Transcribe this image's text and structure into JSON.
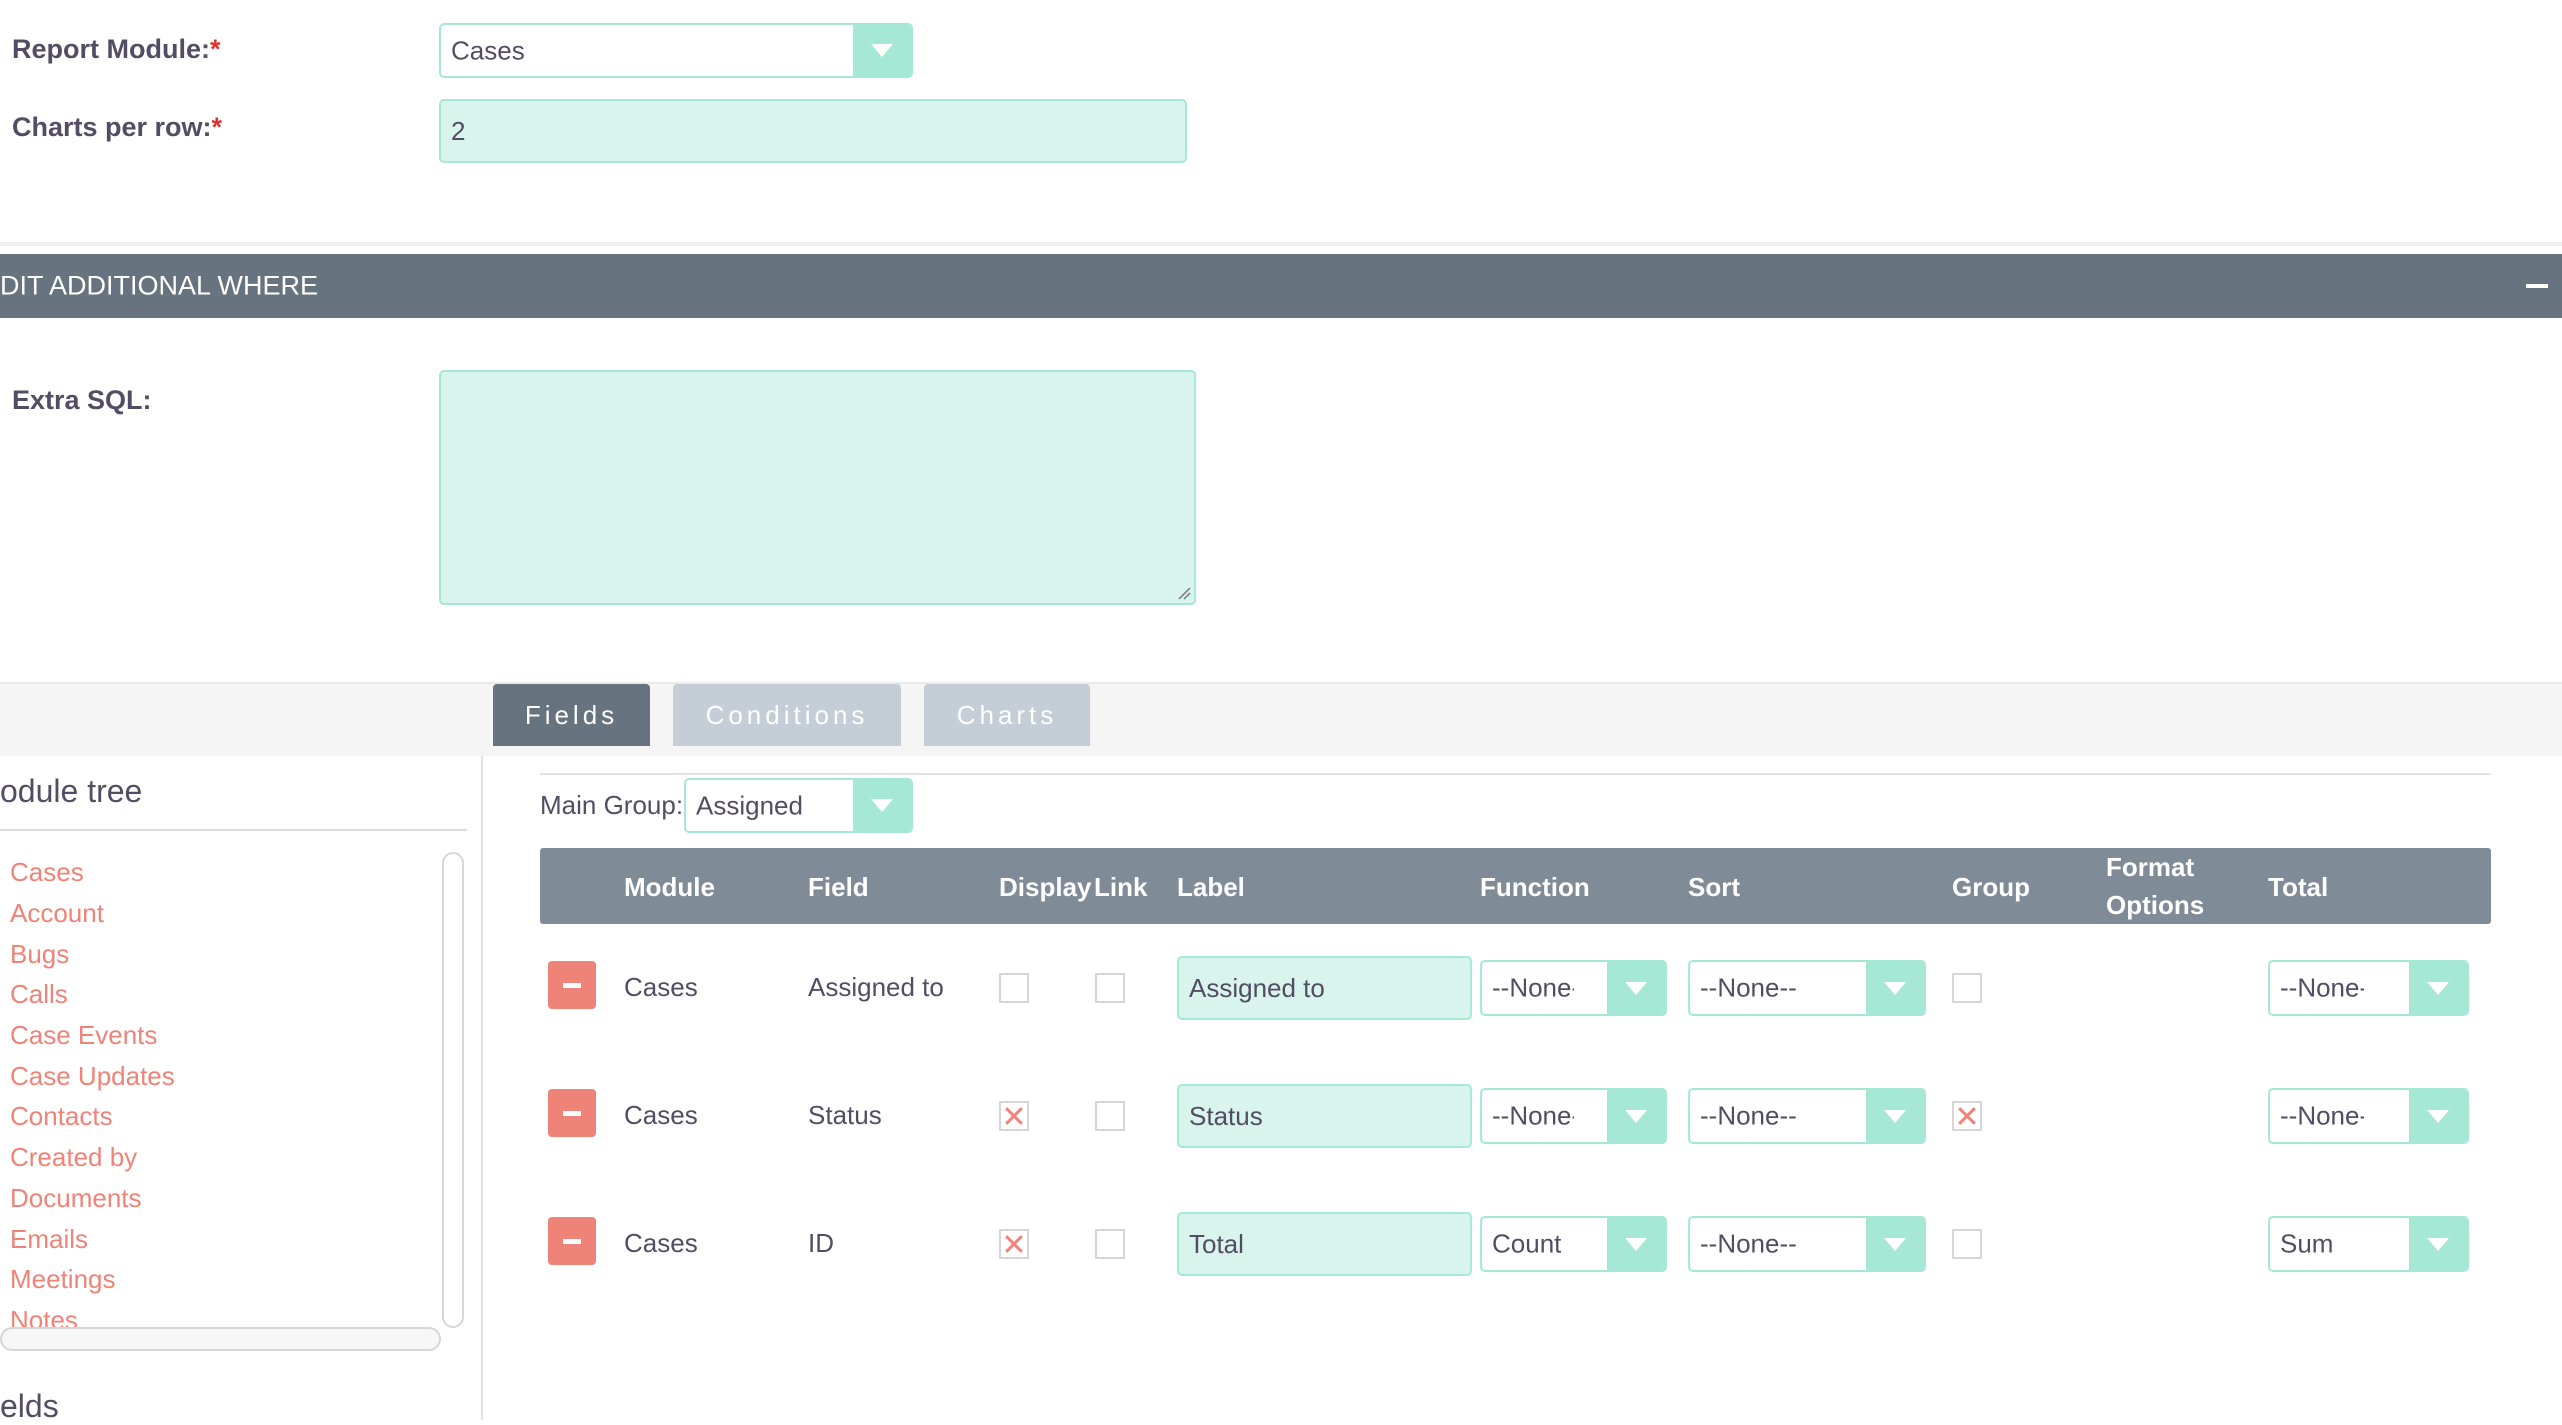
{
  "form": {
    "report_module_label": "Report Module:",
    "report_module_value": "Cases",
    "charts_per_row_label": "Charts per row:",
    "charts_per_row_value": "2",
    "required_mark": "*"
  },
  "section": {
    "title": "DIT ADDITIONAL WHERE",
    "extra_sql_label": "Extra SQL:",
    "extra_sql_value": ""
  },
  "tabs": {
    "fields": "Fields",
    "conditions": "Conditions",
    "charts": "Charts"
  },
  "tree": {
    "title": "odule tree",
    "items": [
      "Cases",
      "Account",
      "Bugs",
      "Calls",
      "Case Events",
      "Case Updates",
      "Contacts",
      "Created by",
      "Documents",
      "Emails",
      "Meetings",
      "Notes"
    ],
    "fields_title": "elds"
  },
  "main_group": {
    "label": "Main Group:",
    "value": "Assigned"
  },
  "table": {
    "headers": {
      "module": "Module",
      "field": "Field",
      "display": "Display",
      "link": "Link",
      "label": "Label",
      "function": "Function",
      "sort": "Sort",
      "group": "Group",
      "format_line1": "Format",
      "format_line2": "Options",
      "total": "Total"
    },
    "rows": [
      {
        "module": "Cases",
        "field": "Assigned to",
        "display": false,
        "link": false,
        "label": "Assigned to",
        "function": "--None--",
        "sort": "--None--",
        "group": false,
        "total": "--None--"
      },
      {
        "module": "Cases",
        "field": "Status",
        "display": true,
        "link": false,
        "label": "Status",
        "function": "--None--",
        "sort": "--None--",
        "group": true,
        "total": "--None--"
      },
      {
        "module": "Cases",
        "field": "ID",
        "display": true,
        "link": false,
        "label": "Total",
        "function": "Count",
        "sort": "--None--",
        "group": false,
        "total": "Sum"
      }
    ]
  },
  "colors": {
    "accent": "#a5e8d6",
    "input_fill": "#d8f4ec",
    "header_bar": "#67737e",
    "table_header": "#7f8b96",
    "link": "#f08377",
    "remove": "#f08377"
  }
}
